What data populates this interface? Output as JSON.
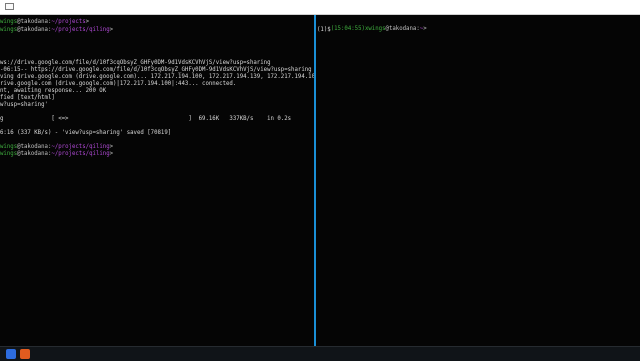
{
  "left_terminal": {
    "lines": [
      {
        "kind": "prompt",
        "user": "wings",
        "host": "takodana",
        "path": "~/projects",
        "suffix": ""
      },
      {
        "kind": "prompt",
        "user": "wings",
        "host": "takodana",
        "path": "~/projects/qiling",
        "suffix": ""
      },
      {
        "kind": "text",
        "text": "ws://drive.google.com/file/d/10f3cqObsyZ_GHFy0DM-9d1VdsKCVhVjS/view?usp=sharing"
      },
      {
        "kind": "text",
        "text": "-06:15-- https://drive.google.com/file/d/10f3cqObsyZ_GHFy0DM-9d1VdsKCVhVjS/view?usp=sharing"
      },
      {
        "kind": "text",
        "text": "ving drive.google.com (drive.google.com)... 172.217.194.100, 172.217.194.139, 172.217.194.101, ..."
      },
      {
        "kind": "text",
        "text": "rive.google.com (drive.google.com)|172.217.194.100|:443... connected."
      },
      {
        "kind": "text",
        "text": "nt, awaiting response... 200 OK"
      },
      {
        "kind": "text",
        "text": "fied [text/html]"
      },
      {
        "kind": "text",
        "text": "w?usp=sharing'"
      },
      {
        "kind": "blank",
        "text": ""
      },
      {
        "kind": "text",
        "text": "g              [ <=>                                   ]  69.16K   337KB/s    in 0.2s"
      },
      {
        "kind": "blank",
        "text": ""
      },
      {
        "kind": "text",
        "text": "6:16 (337 KB/s) - 'view?usp=sharing' saved [70819]"
      },
      {
        "kind": "blank",
        "text": ""
      },
      {
        "kind": "prompt",
        "user": "wings",
        "host": "takodana",
        "path": "~/projects/qiling",
        "suffix": ""
      },
      {
        "kind": "prompt",
        "user": "wings",
        "host": "takodana",
        "path": "~/projects/qiling",
        "suffix": ""
      }
    ]
  },
  "right_terminal": {
    "clock": "(15:04:55)",
    "user": "xwings",
    "host": "takodana",
    "path": "~",
    "second_line": "(1)$"
  },
  "colors": {
    "user": "#3fae3f",
    "path": "#b04ad6",
    "divider": "#1a8fd6",
    "background": "#050505"
  },
  "taskbar": {
    "icons": [
      "windows-start-icon",
      "firefox-icon"
    ]
  }
}
